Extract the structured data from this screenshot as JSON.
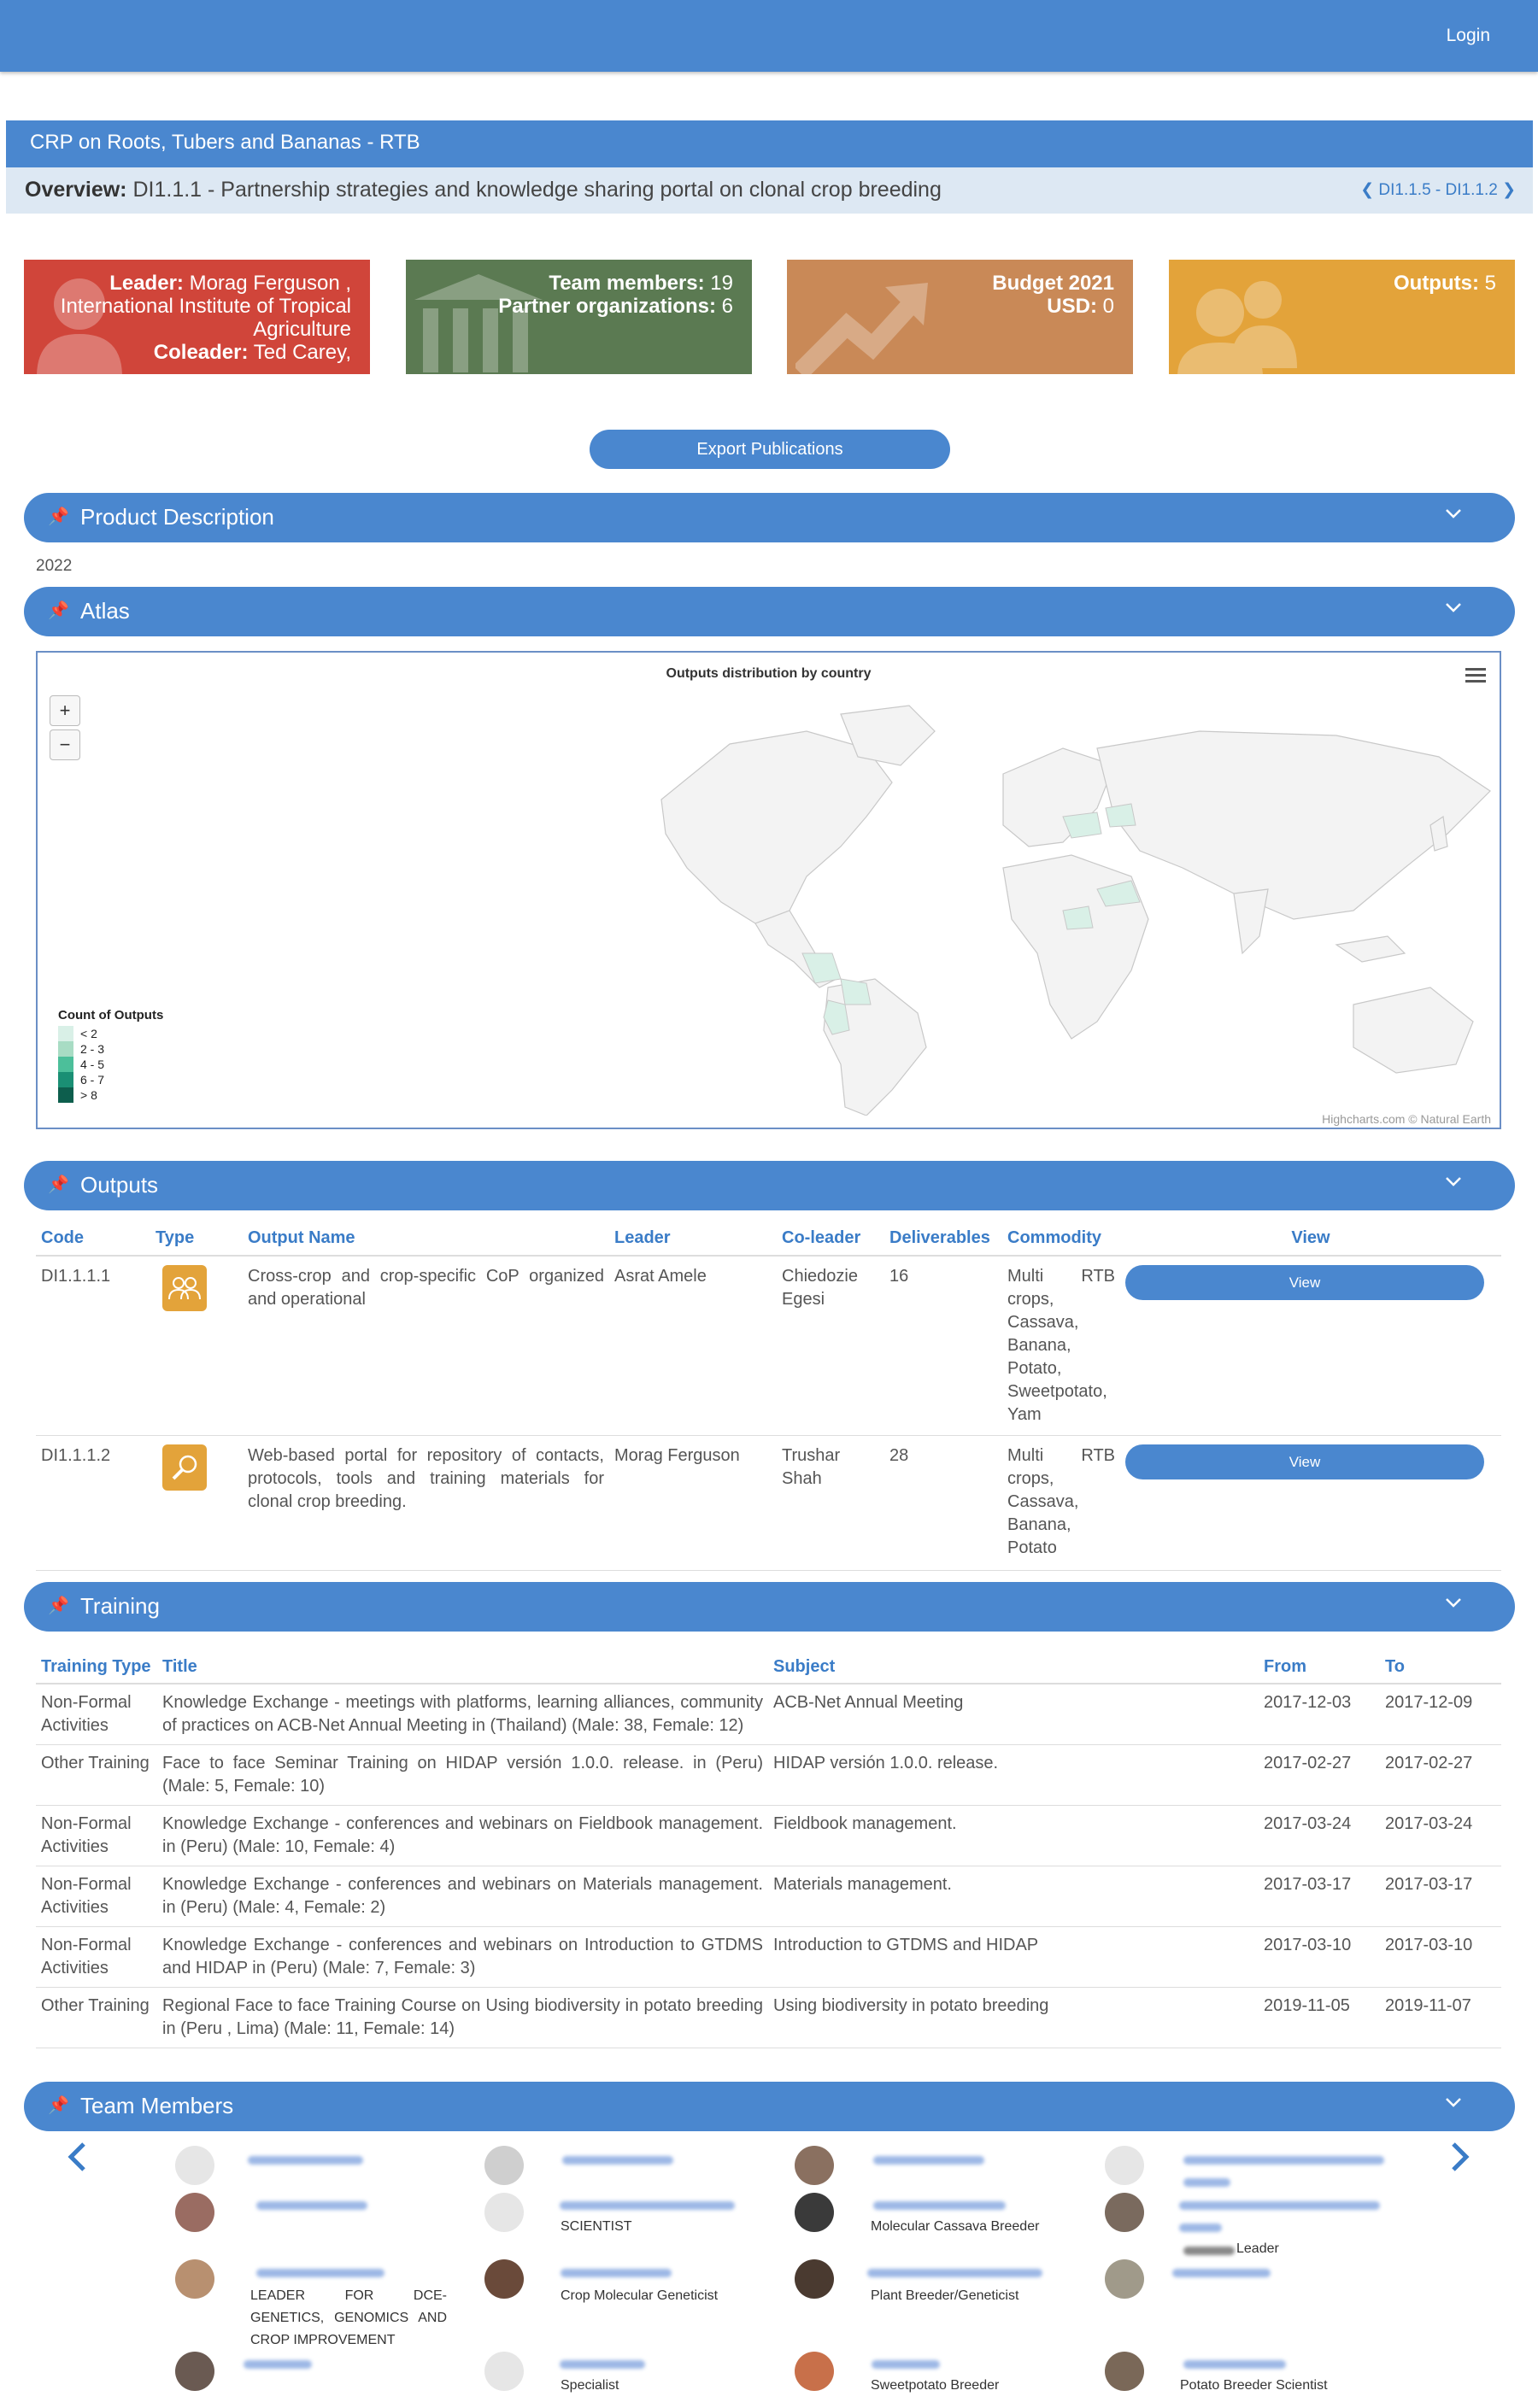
{
  "header": {
    "login_label": "Login"
  },
  "crp_title": "CRP on Roots, Tubers and Bananas - RTB",
  "overview": {
    "label": "Overview:",
    "text": "DI1.1.1 - Partnership strategies and knowledge sharing portal on clonal crop breeding",
    "nav": "DI1.1.5 - DI1.1.2"
  },
  "tiles": {
    "leader_label": "Leader:",
    "leader_value": "Morag Ferguson ,",
    "leader_org": "International Institute of Tropical Agriculture",
    "coleader_label": "Coleader:",
    "coleader_value": "Ted Carey,",
    "team_label": "Team members:",
    "team_value": "19",
    "partner_label": "Partner organizations:",
    "partner_value": "6",
    "budget_label": "Budget 2021",
    "budget_usd_label": "USD:",
    "budget_value": "0",
    "outputs_label": "Outputs:",
    "outputs_value": "5"
  },
  "export_button": "Export Publications",
  "sections": {
    "product_description": "Product Description",
    "atlas": "Atlas",
    "outputs": "Outputs",
    "training": "Training",
    "team": "Team Members"
  },
  "year": "2022",
  "atlas": {
    "chart_title": "Outputs distribution by country",
    "zoom_in": "+",
    "zoom_out": "−",
    "legend_title": "Count of Outputs",
    "legend": [
      {
        "label": "< 2",
        "color": "#d9f0e7"
      },
      {
        "label": "2 - 3",
        "color": "#a8dcc4"
      },
      {
        "label": "4 - 5",
        "color": "#4cbf9a"
      },
      {
        "label": "6 - 7",
        "color": "#1a8f74"
      },
      {
        "label": "> 8",
        "color": "#0d5e4d"
      }
    ],
    "credit": "Highcharts.com © Natural Earth"
  },
  "outputs_table": {
    "headers": [
      "Code",
      "Type",
      "Output Name",
      "Leader",
      "Co-leader",
      "Deliverables",
      "Commodity",
      "View"
    ],
    "rows": [
      {
        "code": "DI1.1.1.1",
        "name": "Cross-crop and crop-specific CoP organized and operational",
        "leader": "Asrat Amele",
        "coleader": "Chiedozie Egesi",
        "deliverables": "16",
        "commodity": "Multi RTB crops, Cassava, Banana, Potato, Sweetpotato, Yam",
        "view": "View",
        "icon": "people-icon"
      },
      {
        "code": "DI1.1.1.2",
        "name": "Web-based portal for repository of contacts, protocols, tools and training materials for clonal crop breeding.",
        "leader": "Morag Ferguson",
        "coleader": "Trushar Shah",
        "deliverables": "28",
        "commodity": "Multi RTB crops, Cassava, Banana, Potato",
        "view": "View",
        "icon": "search-tool-icon"
      }
    ]
  },
  "training_table": {
    "headers": [
      "Training Type",
      "Title",
      "Subject",
      "From",
      "To"
    ],
    "rows": [
      {
        "type": "Non-Formal Activities",
        "title": "Knowledge Exchange - meetings with platforms, learning alliances, community of practices on ACB-Net Annual Meeting in (Thailand) (Male: 38, Female: 12)",
        "subject": "ACB-Net Annual Meeting",
        "from": "2017-12-03",
        "to": "2017-12-09"
      },
      {
        "type": "Other Training",
        "title": "Face to face Seminar Training on HIDAP versión 1.0.0. release. in (Peru) (Male: 5, Female: 10)",
        "subject": "HIDAP versión 1.0.0. release.",
        "from": "2017-02-27",
        "to": "2017-02-27"
      },
      {
        "type": "Non-Formal Activities",
        "title": "Knowledge Exchange - conferences and webinars on Fieldbook management. in (Peru) (Male: 10, Female: 4)",
        "subject": "Fieldbook management.",
        "from": "2017-03-24",
        "to": "2017-03-24"
      },
      {
        "type": "Non-Formal Activities",
        "title": "Knowledge Exchange - conferences and webinars on Materials management. in (Peru) (Male: 4, Female: 2)",
        "subject": "Materials management.",
        "from": "2017-03-17",
        "to": "2017-03-17"
      },
      {
        "type": "Non-Formal Activities",
        "title": "Knowledge Exchange - conferences and webinars on Introduction to GTDMS and HIDAP in (Peru) (Male: 7, Female: 3)",
        "subject": "Introduction to GTDMS and HIDAP",
        "from": "2017-03-10",
        "to": "2017-03-10"
      },
      {
        "type": "Other Training",
        "title": "Regional Face to face Training Course on Using biodiversity in potato breeding in (Peru , Lima) (Male: 11, Female: 14)",
        "subject": "Using biodiversity in potato breeding",
        "from": "2019-11-05",
        "to": "2019-11-07"
      }
    ]
  },
  "team": {
    "roles": {
      "r1": "SCIENTIST",
      "r2": "Molecular Cassava Breeder",
      "r3": "Leader",
      "r4": "LEADER FOR DCE-GENETICS, GENOMICS AND CROP IMPROVEMENT",
      "r5": "Crop Molecular Geneticist",
      "r6": "Plant Breeder/Geneticist",
      "r7": "Specialist",
      "r8": "Sweetpotato Breeder",
      "r9": "Potato Breeder Scientist"
    },
    "colors": {
      "accent": "#4a87cf",
      "blur": "#9db8e6"
    }
  }
}
